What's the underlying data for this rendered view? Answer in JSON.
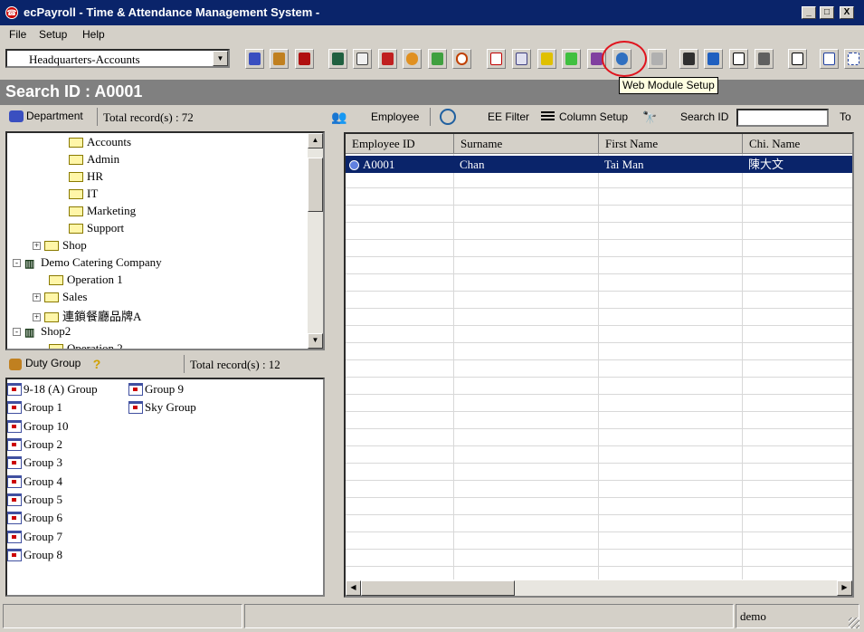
{
  "window": {
    "title": "ecPayroll - Time & Attendance Management System -",
    "controls": [
      "_",
      "□",
      "X"
    ]
  },
  "menu": [
    "File",
    "Setup",
    "Help"
  ],
  "toolbar": {
    "department_select": "Headquarters-Accounts",
    "tooltip": "Web Module Setup"
  },
  "search_banner": "Search ID : A0001",
  "department_panel": {
    "title": "Department",
    "total": "Total record(s) : 72",
    "tree": [
      {
        "label": "Accounts",
        "type": "folder",
        "level": 3
      },
      {
        "label": "Admin",
        "type": "folder",
        "level": 3
      },
      {
        "label": "HR",
        "type": "folder",
        "level": 3
      },
      {
        "label": "IT",
        "type": "folder",
        "level": 3
      },
      {
        "label": "Marketing",
        "type": "folder",
        "level": 3
      },
      {
        "label": "Support",
        "type": "folder",
        "level": 3
      },
      {
        "label": "Shop",
        "type": "folder",
        "level": 2,
        "expander": "+"
      },
      {
        "label": "Demo Catering Company",
        "type": "company",
        "level": 1,
        "expander": "-"
      },
      {
        "label": "Operation 1",
        "type": "folder",
        "level": 2
      },
      {
        "label": "Sales",
        "type": "folder",
        "level": 2,
        "expander": "+"
      },
      {
        "label": "連鎖餐廳品牌A",
        "type": "folder",
        "level": 2,
        "expander": "+"
      },
      {
        "label": "Shop2",
        "type": "company",
        "level": 1,
        "expander": "-"
      },
      {
        "label": "Operation 2",
        "type": "folder",
        "level": 2
      }
    ]
  },
  "duty_group_panel": {
    "title": "Duty Group",
    "total": "Total record(s) : 12",
    "col1": [
      "9-18 (A) Group",
      "Group 1",
      "Group 10",
      "Group 2",
      "Group 3",
      "Group 4",
      "Group 5",
      "Group 6",
      "Group 7",
      "Group 8"
    ],
    "col2": [
      "Group 9",
      "Sky Group"
    ]
  },
  "employee_bar": {
    "employee_label": "Employee",
    "filter_label": "EE Filter",
    "column_setup_label": "Column Setup",
    "search_label": "Search ID",
    "search_value": "",
    "cut_label": "To"
  },
  "grid": {
    "columns": [
      "Employee ID",
      "Surname",
      "First Name",
      "Chi. Name"
    ],
    "rows": [
      [
        "A0001",
        "Chan",
        "Tai Man",
        "陳大文"
      ]
    ]
  },
  "status_bar": {
    "user": "demo"
  },
  "colors": {
    "titlebar": "#0a246a",
    "selection": "#0a246a",
    "highlight_circle": "#e0141e",
    "tooltip_bg": "#ffffe1"
  }
}
